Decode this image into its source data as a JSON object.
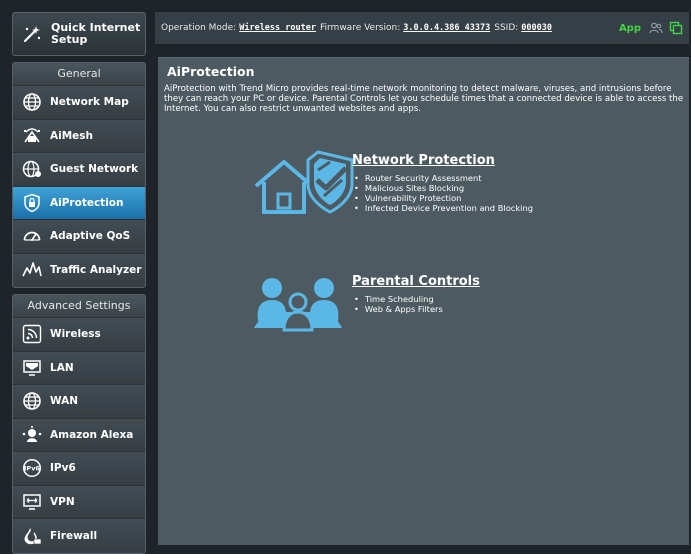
{
  "sidebar": {
    "quick_setup": {
      "label_line1": "Quick Internet",
      "label_line2": "Setup",
      "icon": "wand-icon"
    },
    "general": {
      "heading": "General",
      "items": [
        {
          "label": "Network Map",
          "icon": "globe-icon"
        },
        {
          "label": "AiMesh",
          "icon": "mesh-router-icon"
        },
        {
          "label": "Guest Network",
          "icon": "guest-globe-icon"
        },
        {
          "label": "AiProtection",
          "icon": "lock-shield-icon",
          "active": true
        },
        {
          "label": "Adaptive QoS",
          "icon": "speedometer-icon"
        },
        {
          "label": "Traffic Analyzer",
          "icon": "analyzer-icon"
        }
      ]
    },
    "advanced": {
      "heading": "Advanced Settings",
      "items": [
        {
          "label": "Wireless",
          "icon": "wifi-icon"
        },
        {
          "label": "LAN",
          "icon": "monitor-icon"
        },
        {
          "label": "WAN",
          "icon": "globe-icon"
        },
        {
          "label": "Amazon Alexa",
          "icon": "alexa-icon"
        },
        {
          "label": "IPv6",
          "icon": "ipv6-icon"
        },
        {
          "label": "VPN",
          "icon": "vpn-icon"
        },
        {
          "label": "Firewall",
          "icon": "firewall-icon"
        }
      ]
    }
  },
  "topbar": {
    "op_mode_label": "Operation Mode:",
    "op_mode_value": "Wireless router",
    "fw_label": "Firmware Version:",
    "fw_value": "3.0.0.4.386_43373",
    "ssid_label": "SSID:",
    "ssid_value": "000030",
    "app_label": "App",
    "icons": [
      "users-icon",
      "copy-icon"
    ]
  },
  "main": {
    "title": "AiProtection",
    "description": "AiProtection with Trend Micro provides real-time network monitoring to detect malware, viruses, and intrusions before they can reach your PC or device. Parental Controls let you schedule times that a connected device is able to access the Internet. You can also restrict unwanted websites and apps.",
    "network_protection": {
      "title": "Network Protection",
      "bullets": [
        "Router Security Assessment",
        "Malicious Sites Blocking",
        "Vulnerability Protection",
        "Infected Device Prevention and Blocking"
      ]
    },
    "parental_controls": {
      "title": "Parental Controls",
      "bullets": [
        "Time Scheduling",
        "Web & Apps Filters"
      ]
    }
  },
  "colors": {
    "accent": "#2a8ccb",
    "illustration": "#5bb8e6",
    "app_green": "#43d443",
    "panel": "#4d5a61"
  }
}
